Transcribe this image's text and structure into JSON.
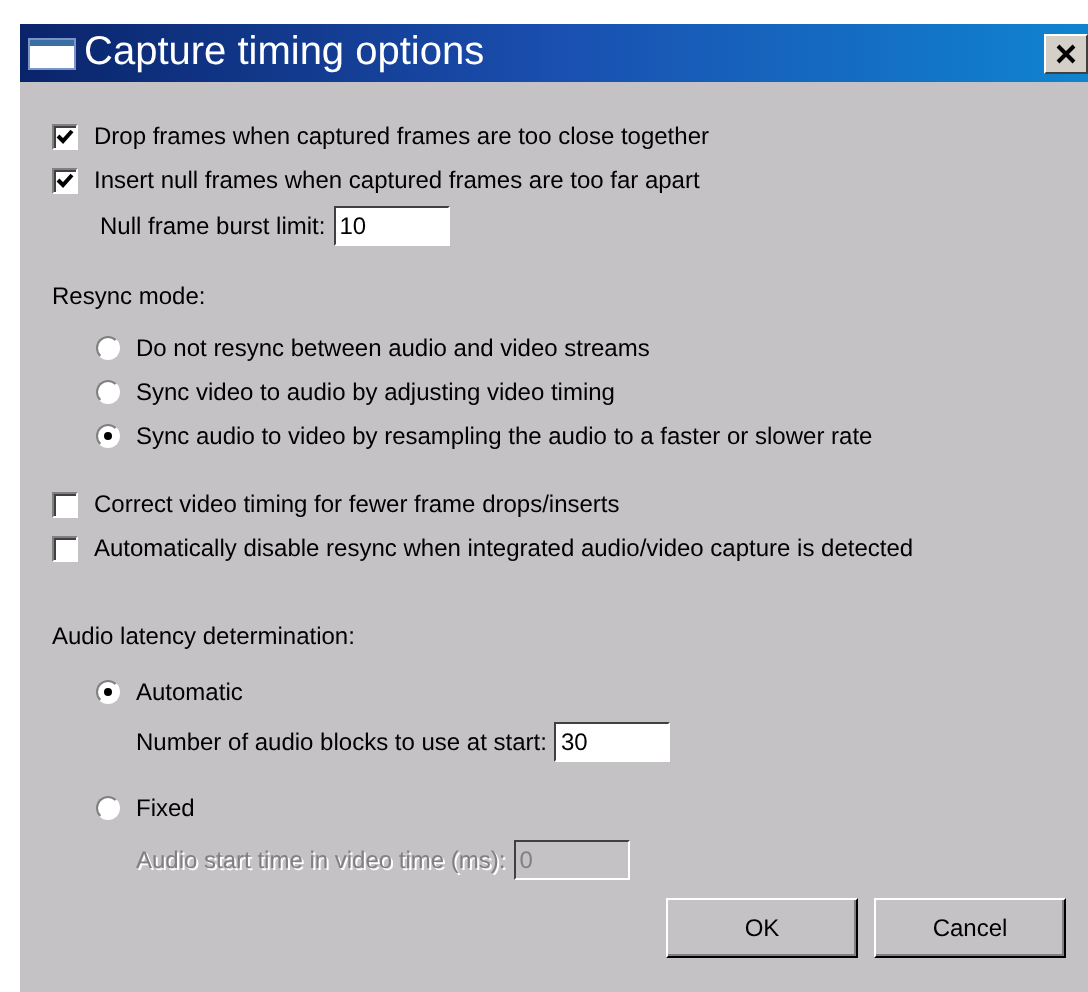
{
  "window": {
    "title": "Capture timing options"
  },
  "frame_options": [
    {
      "label": "Drop frames when captured frames are too close together",
      "checked": true
    },
    {
      "label": "Insert null frames when captured frames are too far apart",
      "checked": true
    }
  ],
  "burst_limit": {
    "label": "Null frame burst limit:",
    "value": "10"
  },
  "resync": {
    "label": "Resync mode:",
    "options": [
      {
        "label": "Do not resync between audio and video streams",
        "selected": false
      },
      {
        "label": "Sync video to audio by adjusting video timing",
        "selected": false
      },
      {
        "label": "Sync audio to video by resampling the audio to a faster or slower rate",
        "selected": true
      }
    ]
  },
  "extra_options": [
    {
      "label": "Correct video timing for fewer frame drops/inserts",
      "checked": false
    },
    {
      "label": "Automatically disable resync when integrated audio/video capture is detected",
      "checked": false
    }
  ],
  "latency": {
    "label": "Audio latency determination:",
    "options": [
      {
        "label": "Automatic",
        "selected": true,
        "field": {
          "label": "Number of audio blocks to use at start:",
          "value": "30",
          "disabled": false
        }
      },
      {
        "label": "Fixed",
        "selected": false,
        "field": {
          "label": "Audio start time in video time (ms):",
          "value": "0",
          "disabled": true
        }
      }
    ]
  },
  "buttons": [
    {
      "label": "OK"
    },
    {
      "label": "Cancel"
    }
  ]
}
